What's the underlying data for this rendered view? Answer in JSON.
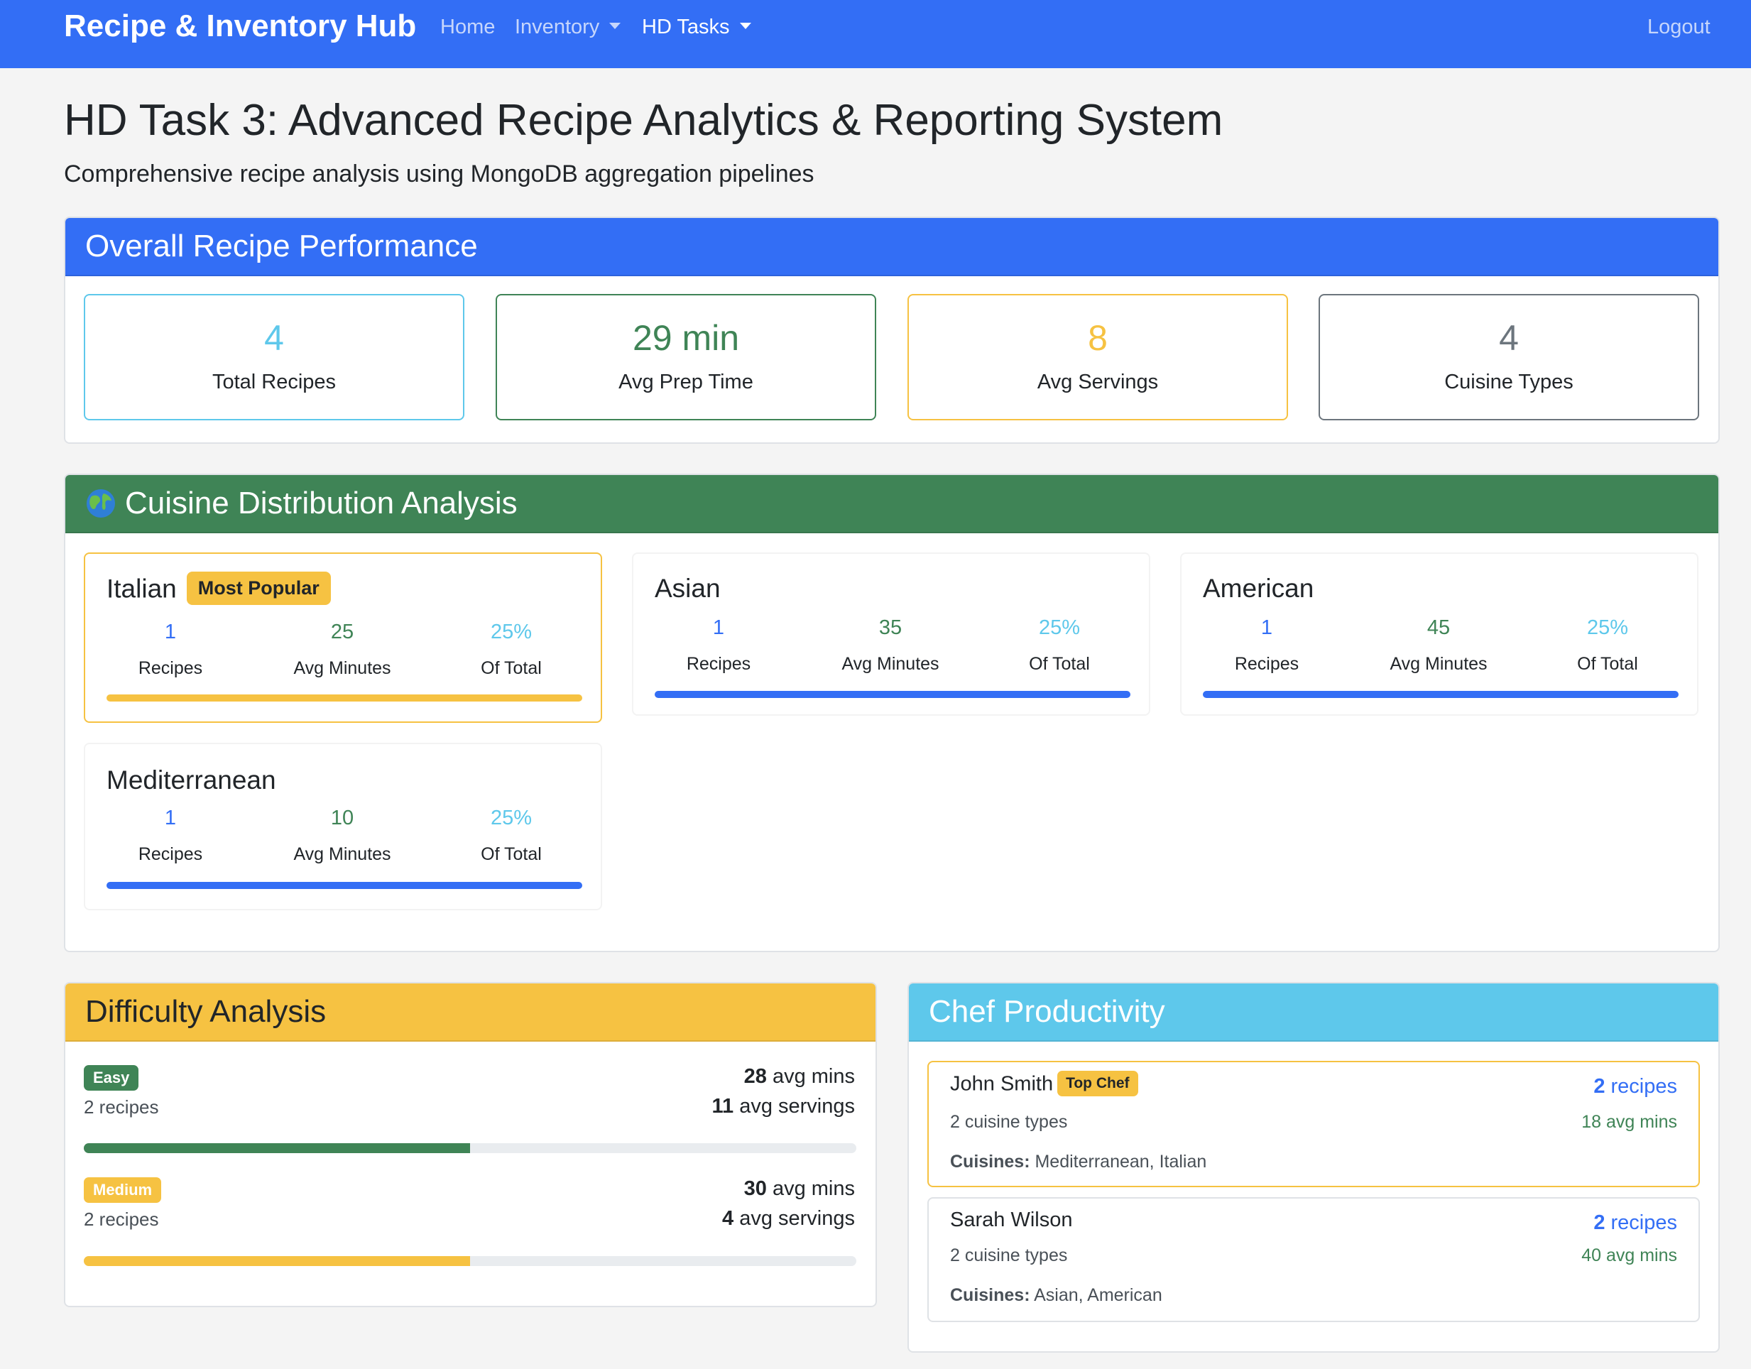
{
  "navbar": {
    "brand": "Recipe & Inventory Hub",
    "links": [
      "Home",
      "Inventory",
      "HD Tasks"
    ],
    "logout": "Logout"
  },
  "page": {
    "title": "HD Task 3: Advanced Recipe Analytics & Reporting System",
    "subtitle": "Comprehensive recipe analysis using MongoDB aggregation pipelines"
  },
  "overall": {
    "header": "Overall Recipe Performance",
    "stats": [
      {
        "value": "4",
        "label": "Total Recipes",
        "color": "#5ec8eb"
      },
      {
        "value": "29 min",
        "label": "Avg Prep Time",
        "color": "#3f8456"
      },
      {
        "value": "8",
        "label": "Avg Servings",
        "color": "#f6c242"
      },
      {
        "value": "4",
        "label": "Cuisine Types",
        "color": "#6c757d"
      }
    ]
  },
  "cuisine": {
    "header_icon": "globe-icon",
    "header": "Cuisine Distribution Analysis",
    "popular_badge": "Most Popular",
    "stat_labels": {
      "recipes": "Recipes",
      "minutes": "Avg Minutes",
      "total": "Of Total"
    },
    "items": [
      {
        "name": "Italian",
        "recipes": "1",
        "avg_minutes": "25",
        "of_total": "25%",
        "share": 0.25,
        "bar_color": "#f6c242"
      },
      {
        "name": "Asian",
        "recipes": "1",
        "avg_minutes": "35",
        "of_total": "25%",
        "share": 0.25,
        "bar_color": "#336ef5"
      },
      {
        "name": "American",
        "recipes": "1",
        "avg_minutes": "45",
        "of_total": "25%",
        "share": 0.25,
        "bar_color": "#336ef5"
      },
      {
        "name": "Mediterranean",
        "recipes": "1",
        "avg_minutes": "10",
        "of_total": "25%",
        "share": 0.25,
        "bar_color": "#336ef5"
      }
    ]
  },
  "difficulty": {
    "header": "Difficulty Analysis",
    "items": [
      {
        "level": "Easy",
        "recipes": "2 recipes",
        "avg_mins_num": "28",
        "avg_mins_txt": " avg mins",
        "avg_serv_num": "11",
        "avg_serv_txt": " avg servings",
        "progress": 0.5,
        "color": "#3f8456"
      },
      {
        "level": "Medium",
        "recipes": "2 recipes",
        "avg_mins_num": "30",
        "avg_mins_txt": " avg mins",
        "avg_serv_num": "4",
        "avg_serv_txt": " avg servings",
        "progress": 0.5,
        "color": "#f6c242"
      }
    ]
  },
  "chefs": {
    "header": "Chef Productivity",
    "top_badge": "Top Chef",
    "cuisines_label": "Cuisines:",
    "items": [
      {
        "name": "John Smith",
        "cuisine_types": "2 cuisine types",
        "recipes_num": "2",
        "recipes_txt": " recipes",
        "avg_mins": "18 avg mins",
        "cuisines": " Mediterranean, Italian"
      },
      {
        "name": "Sarah Wilson",
        "cuisine_types": "2 cuisine types",
        "recipes_num": "2",
        "recipes_txt": " recipes",
        "avg_mins": "40 avg mins",
        "cuisines": " Asian, American"
      }
    ]
  }
}
